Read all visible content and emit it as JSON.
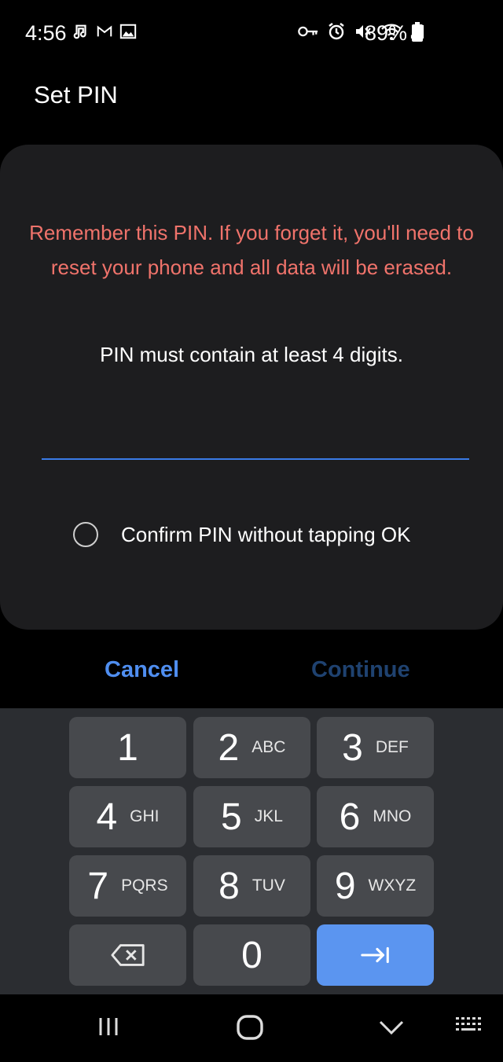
{
  "status_bar": {
    "time": "4:56",
    "battery": "89%",
    "left_icons": [
      "music-note-icon",
      "gmail-icon",
      "gallery-icon"
    ],
    "right_icons": [
      "vpn-key-icon",
      "alarm-icon",
      "mute-icon",
      "wifi-icon",
      "signal-icon",
      "battery-icon"
    ]
  },
  "header": {
    "title": "Set PIN"
  },
  "card": {
    "warning": "Remember this PIN. If you forget it, you'll need to reset your phone and all data will be erased.",
    "hint": "PIN must contain at least 4 digits.",
    "pin_value": "",
    "confirm_option": {
      "label": "Confirm PIN without tapping OK",
      "checked": false
    }
  },
  "actions": {
    "cancel_label": "Cancel",
    "continue_label": "Continue"
  },
  "keypad": {
    "keys": [
      {
        "num": "1",
        "letters": ""
      },
      {
        "num": "2",
        "letters": "ABC"
      },
      {
        "num": "3",
        "letters": "DEF"
      },
      {
        "num": "4",
        "letters": "GHI"
      },
      {
        "num": "5",
        "letters": "JKL"
      },
      {
        "num": "6",
        "letters": "MNO"
      },
      {
        "num": "7",
        "letters": "PQRS"
      },
      {
        "num": "8",
        "letters": "TUV"
      },
      {
        "num": "9",
        "letters": "WXYZ"
      },
      {
        "num": "",
        "letters": ""
      },
      {
        "num": "0",
        "letters": ""
      },
      {
        "num": "",
        "letters": ""
      }
    ],
    "special_icons": {
      "delete": "backspace-icon",
      "enter": "next-arrow-icon"
    }
  },
  "nav_bar": {
    "icons": [
      "recents-icon",
      "home-icon",
      "back-chevron-icon",
      "keyboard-icon"
    ]
  },
  "colors": {
    "warning_text": "#f0736b",
    "accent": "#4f8ef0",
    "continue_disabled": "#1f4270",
    "enter_key": "#5b95f0",
    "key_bg": "#47494d",
    "keyboard_bg": "#2b2d31",
    "card_bg": "#1d1d1f"
  }
}
